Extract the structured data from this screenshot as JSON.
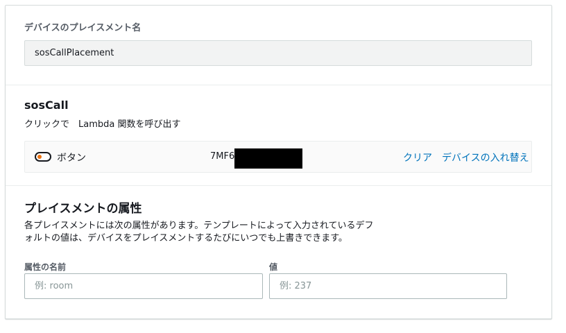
{
  "placement_name": {
    "label": "デバイスのプレイスメント名",
    "value": "sosCallPlacement"
  },
  "device_section": {
    "title": "sosCall",
    "description": "クリックで　Lambda 関数を呼び出す",
    "device": {
      "icon": "toggle-switch-icon",
      "type_label": "ボタン",
      "id_partial": "7MF6.",
      "clear_link": "クリア",
      "replace_link": "デバイスの入れ替え"
    }
  },
  "attributes_section": {
    "title": "プレイスメントの属性",
    "description_line1": "各プレイスメントには次の属性があります。テンプレートによって入力されているデフ",
    "description_line2": "ォルトの値は、デバイスをプレイスメントするたびにいつでも上書きできます。",
    "name_label": "属性の名前",
    "name_placeholder": "例: room",
    "value_label": "値",
    "value_placeholder": "例: 237"
  },
  "colors": {
    "link": "#0073bb",
    "toggle_accent": "#ec7211",
    "readonly_bg": "#f2f3f3"
  }
}
